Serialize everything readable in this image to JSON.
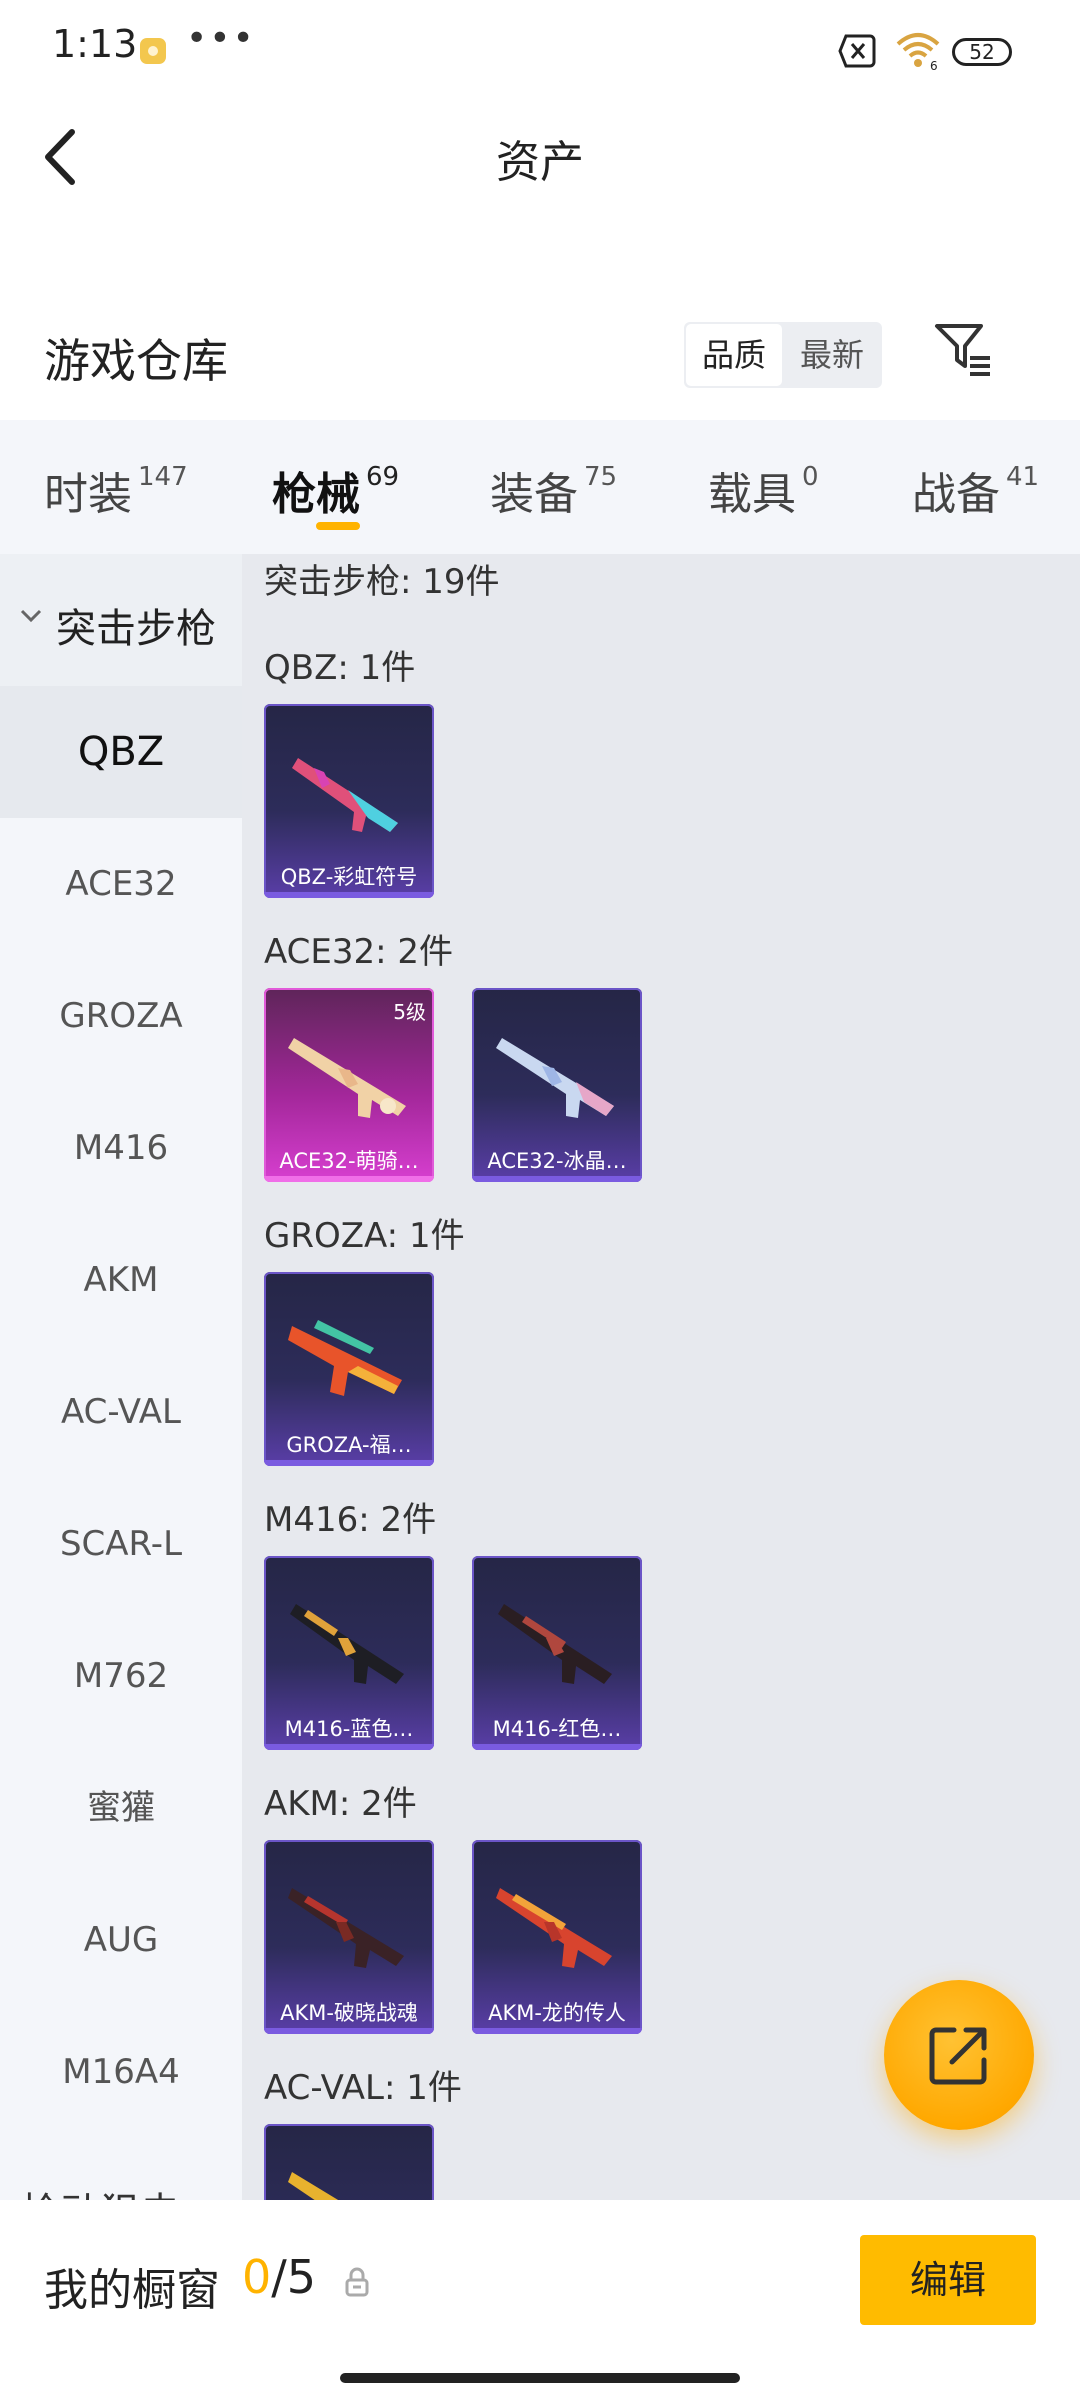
{
  "status_bar": {
    "time": "1:13",
    "more": "•••",
    "battery": "52"
  },
  "header": {
    "title": "资产"
  },
  "warehouse": {
    "title": "游戏仓库",
    "sort_quality": "品质",
    "sort_latest": "最新"
  },
  "tabs": [
    {
      "label": "时装",
      "count": "147"
    },
    {
      "label": "枪械",
      "count": "69",
      "active": true
    },
    {
      "label": "装备",
      "count": "75"
    },
    {
      "label": "载具",
      "count": "0"
    },
    {
      "label": "战备",
      "count": "41"
    }
  ],
  "sidebar": {
    "group": "突击步枪",
    "items": [
      "QBZ",
      "ACE32",
      "GROZA",
      "M416",
      "AKM",
      "AC-VAL",
      "SCAR-L",
      "M762",
      "蜜獾",
      "AUG",
      "M16A4"
    ],
    "active_item": "QBZ",
    "next_group": "栓动狙击"
  },
  "content": {
    "category_title": "突击步枪: 19件",
    "sections": [
      {
        "title": "QBZ: 1件",
        "cards": [
          {
            "label": "QBZ-彩虹符号"
          }
        ]
      },
      {
        "title": "ACE32: 2件",
        "cards": [
          {
            "label": "ACE32-萌骑…",
            "level": "5级",
            "rarity": "legendary-pink"
          },
          {
            "label": "ACE32-冰晶…"
          }
        ]
      },
      {
        "title": "GROZA: 1件",
        "cards": [
          {
            "label": "GROZA-福…"
          }
        ]
      },
      {
        "title": "M416: 2件",
        "cards": [
          {
            "label": "M416-蓝色…"
          },
          {
            "label": "M416-红色…"
          }
        ]
      },
      {
        "title": "AKM: 2件",
        "cards": [
          {
            "label": "AKM-破晓战魂"
          },
          {
            "label": "AKM-龙的传人"
          }
        ]
      },
      {
        "title": "AC-VAL: 1件",
        "cards": [
          {
            "label": ""
          }
        ]
      }
    ]
  },
  "bottom_bar": {
    "showcase_label": "我的橱窗",
    "showcase_current": "0",
    "showcase_sep": "/",
    "showcase_total": "5",
    "edit_label": "编辑"
  },
  "colors": {
    "accent": "#ffb300",
    "card_purple": "#5a3ea8",
    "card_pink": "#d73fd0",
    "background": "#e7e9ee"
  },
  "icons": {
    "back": "chevron-left-icon",
    "filter": "filter-icon",
    "share": "share-external-icon",
    "lock": "lock-icon"
  }
}
